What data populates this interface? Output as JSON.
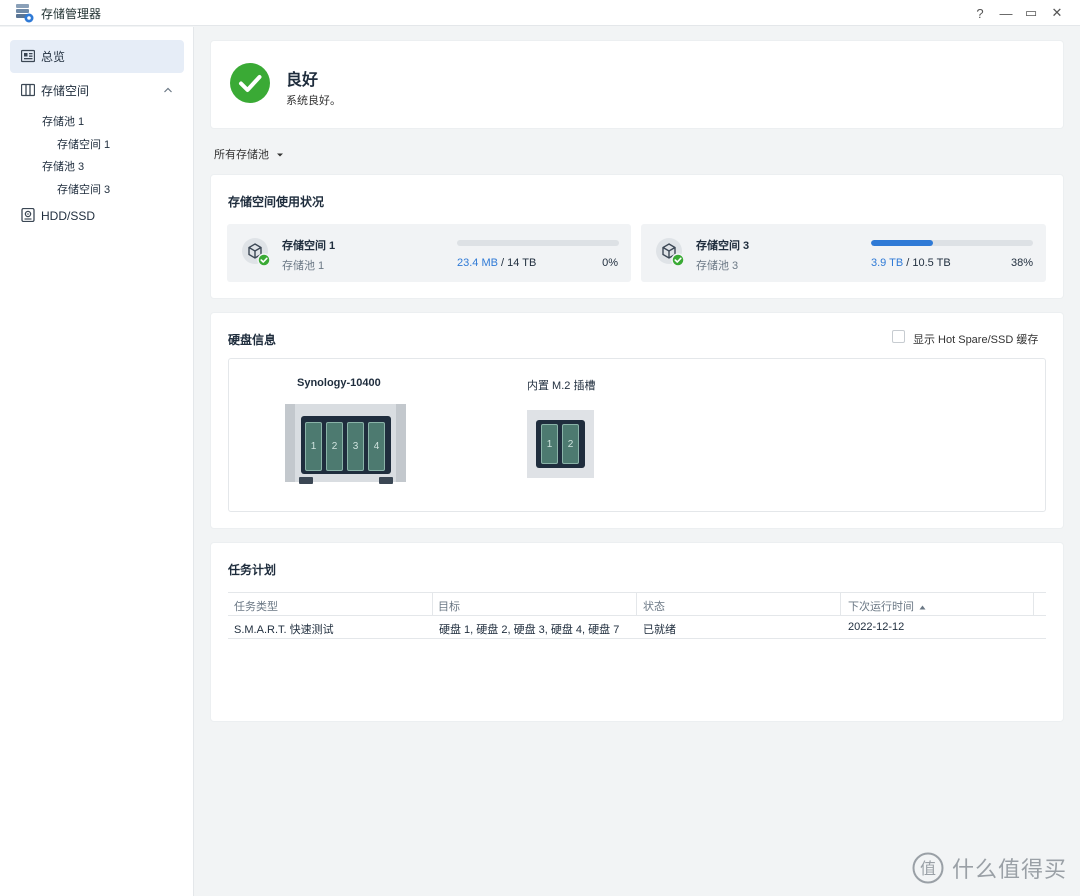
{
  "window": {
    "title": "存储管理器",
    "controls": {
      "help": "?",
      "minimize": "—",
      "maximize": "▭",
      "close": "✕"
    }
  },
  "sidebar": {
    "overview": "总览",
    "storage": "存储空间",
    "pool1": "存储池 1",
    "volume1": "存储空间 1",
    "pool3": "存储池 3",
    "volume3": "存储空间 3",
    "hdd": "HDD/SSD"
  },
  "status": {
    "title": "良好",
    "subtitle": "系统良好。",
    "color": "#3aaa35"
  },
  "filter": {
    "label": "所有存储池"
  },
  "usage": {
    "heading": "存储空间使用状况",
    "volumes": [
      {
        "name": "存储空间 1",
        "pool": "存储池 1",
        "used": "23.4 MB",
        "sep": " / ",
        "total": "14 TB",
        "percent_label": "0%",
        "fraction": 0.0
      },
      {
        "name": "存储空间 3",
        "pool": "存储池 3",
        "used": "3.9 TB",
        "sep": " / ",
        "total": "10.5 TB",
        "percent_label": "38%",
        "fraction": 0.38
      }
    ]
  },
  "disk_info": {
    "heading": "硬盘信息",
    "show_hotspare_label": "显示 Hot Spare/SSD 缓存",
    "nas_name": "Synology-10400",
    "bays": [
      "1",
      "2",
      "3",
      "4"
    ],
    "m2_label": "内置 M.2 插槽",
    "m2_slots": [
      "1",
      "2"
    ]
  },
  "tasks": {
    "heading": "任务计划",
    "columns": [
      "任务类型",
      "目标",
      "状态",
      "下次运行时间"
    ],
    "sort_icon": "sort-ascending-icon",
    "rows": [
      {
        "type": "S.M.A.R.T. 快速测试",
        "target": "硬盘 1, 硬盘 2, 硬盘 3, 硬盘 4, 硬盘 7",
        "status": "已就绪",
        "next_run": "2022-12-12"
      }
    ]
  },
  "watermark": {
    "text": "什么值得买",
    "logo_char": "值"
  },
  "colors": {
    "accent": "#2f7ad6",
    "ok": "#3aaa35",
    "sidebar_active": "#e6edf7"
  }
}
